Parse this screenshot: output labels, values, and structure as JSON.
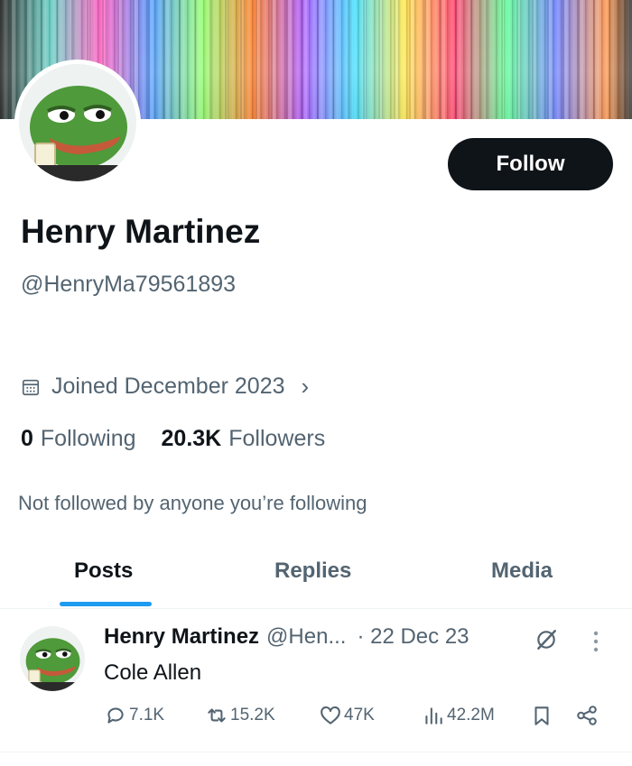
{
  "profile": {
    "name": "Henry Martinez",
    "handle": "@HenryMa79561893",
    "joined": "Joined December 2023",
    "following_count": "0",
    "following_label": "Following",
    "followers_count": "20.3K",
    "followers_label": "Followers",
    "not_followed": "Not followed by anyone you’re following",
    "follow_button": "Follow"
  },
  "tabs": [
    {
      "label": "Posts",
      "active": true
    },
    {
      "label": "Replies",
      "active": false
    },
    {
      "label": "Media",
      "active": false
    }
  ],
  "post": {
    "name": "Henry Martinez",
    "handle": "@Hen...",
    "date": "· 22 Dec 23",
    "text": "Cole Allen",
    "replies": "7.1K",
    "reposts": "15.2K",
    "likes": "47K",
    "views": "42.2M"
  },
  "colors": {
    "text_primary": "#0f1419",
    "text_secondary": "#536471",
    "accent": "#1d9bf0",
    "button_bg": "#0f1419"
  },
  "icons": [
    "calendar-icon",
    "chevron-right-icon",
    "grok-icon",
    "more-icon",
    "reply-icon",
    "repost-icon",
    "like-icon",
    "views-icon",
    "bookmark-icon",
    "share-icon"
  ]
}
